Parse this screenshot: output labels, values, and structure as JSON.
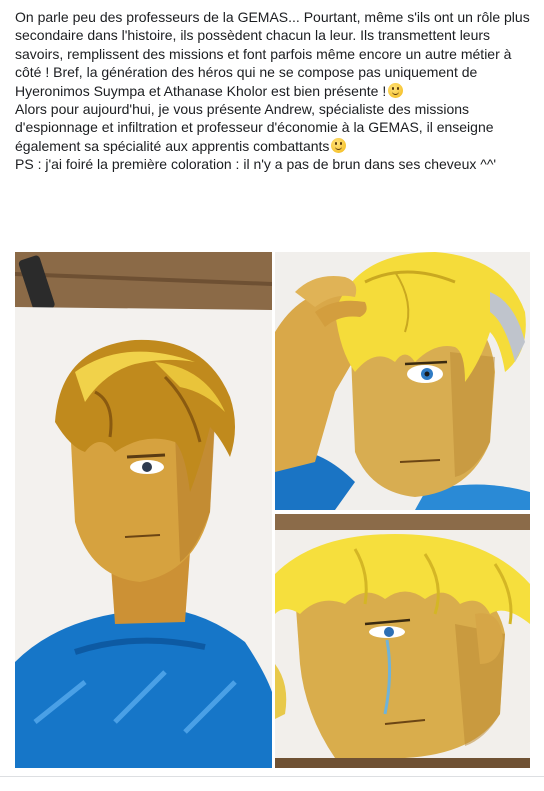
{
  "post": {
    "paragraph_1": "On parle peu des professeurs de la GEMAS... Pourtant, même s'ils ont un rôle plus secondaire dans l'histoire, ils possèdent chacun la leur. Ils transmettent leurs savoirs, remplissent des missions et font parfois même encore un autre métier à côté ! Bref, la génération des héros qui ne se compose pas uniquement de Hyeronimos Suympa et Athanase Kholor est bien présente !",
    "paragraph_2": "Alors pour aujourd'hui, je vous présente Andrew, spécialiste des missions d'espionnage et infiltration et professeur d'économie à la GEMAS, il enseigne également sa spécialité aux apprentis combattants",
    "paragraph_3": "PS : j'ai foiré la première coloration : il n'y a pas de brun dans ses cheveux ^^'",
    "emoji_icon": "smiling-face-icon"
  },
  "photos": [
    {
      "name": "photo-drawing-full-portrait",
      "icon": "image-icon"
    },
    {
      "name": "photo-drawing-hand-in-hair",
      "icon": "image-icon"
    },
    {
      "name": "photo-drawing-tearful-face",
      "icon": "image-icon"
    }
  ],
  "colors": {
    "text": "#1c1e21",
    "wood": "#8a6a45",
    "paper": "#f4f1ec",
    "hair_yellow": "#f2d635",
    "skin_ochre": "#d7a544",
    "shirt_blue": "#1a79c9"
  }
}
